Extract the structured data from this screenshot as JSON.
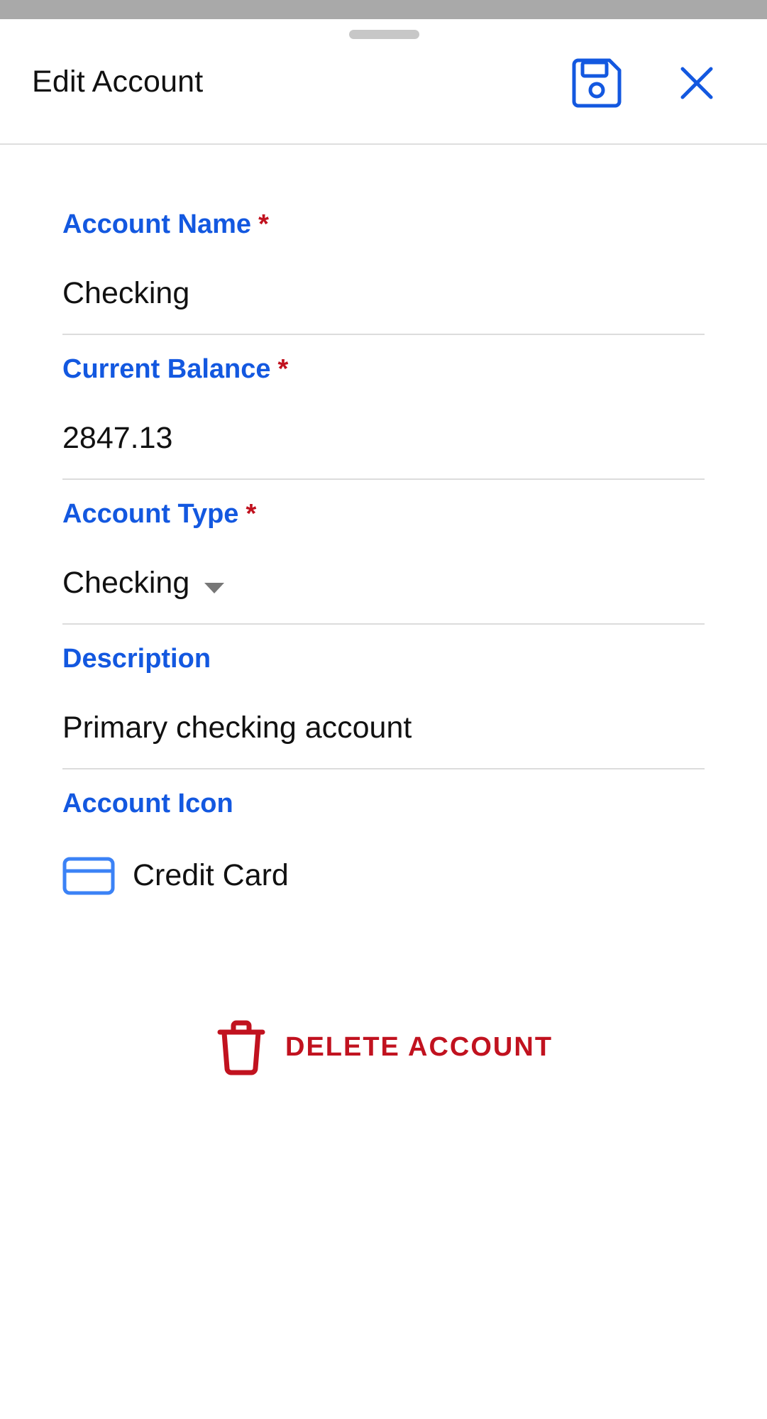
{
  "header": {
    "title": "Edit Account"
  },
  "form": {
    "required_marker": "*",
    "account_name": {
      "label": "Account Name",
      "value": "Checking"
    },
    "current_balance": {
      "label": "Current Balance",
      "value": "2847.13"
    },
    "account_type": {
      "label": "Account Type",
      "value": "Checking"
    },
    "description": {
      "label": "Description",
      "value": "Primary checking account"
    },
    "account_icon": {
      "label": "Account Icon",
      "value": "Credit Card",
      "icon": "credit-card-icon"
    }
  },
  "actions": {
    "delete_label": "DELETE ACCOUNT"
  },
  "colors": {
    "accent": "#1358e0",
    "danger": "#c1121f",
    "divider": "#dcdcdc"
  }
}
